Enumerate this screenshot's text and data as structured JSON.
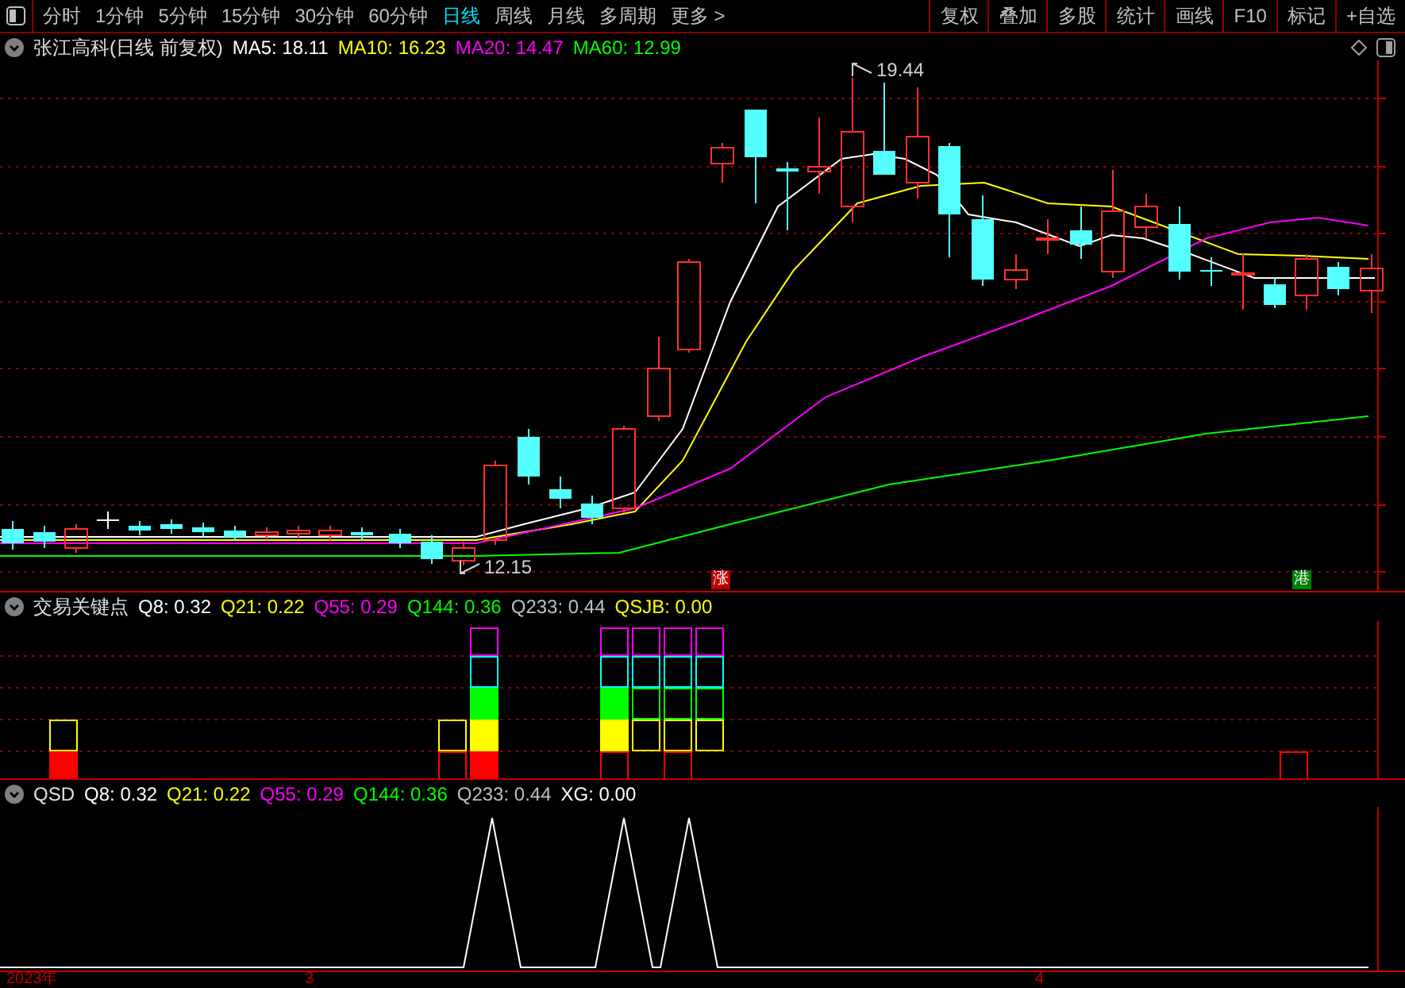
{
  "toolbar": {
    "periods": [
      {
        "label": "分时",
        "selected": false
      },
      {
        "label": "1分钟",
        "selected": false
      },
      {
        "label": "5分钟",
        "selected": false
      },
      {
        "label": "15分钟",
        "selected": false
      },
      {
        "label": "30分钟",
        "selected": false
      },
      {
        "label": "60分钟",
        "selected": false
      },
      {
        "label": "日线",
        "selected": true
      },
      {
        "label": "周线",
        "selected": false
      },
      {
        "label": "月线",
        "selected": false
      },
      {
        "label": "多周期",
        "selected": false
      },
      {
        "label": "更多 >",
        "selected": false
      }
    ],
    "actions": [
      "复权",
      "叠加",
      "多股",
      "统计",
      "画线",
      "F10",
      "标记",
      "+自选"
    ]
  },
  "price_chart": {
    "title": "张江高科(日线 前复权)",
    "indicators": [
      {
        "text": "MA5: 18.11",
        "color": "#ffffff"
      },
      {
        "text": "MA10: 16.23",
        "color": "#ffff00"
      },
      {
        "text": "MA20: 14.47",
        "color": "#ff00ff"
      },
      {
        "text": "MA60: 12.99",
        "color": "#00ff00"
      }
    ],
    "high_label": "19.44",
    "low_label": "12.15",
    "markers": [
      {
        "text": "涨",
        "color": "#c00000"
      },
      {
        "text": "港",
        "color": "#008000"
      }
    ]
  },
  "key_points_panel": {
    "title": "交易关键点",
    "indicators": [
      {
        "text": "Q8: 0.32",
        "color": "#ffffff"
      },
      {
        "text": "Q21: 0.22",
        "color": "#ffff00"
      },
      {
        "text": "Q55: 0.29",
        "color": "#ff00ff"
      },
      {
        "text": "Q144: 0.36",
        "color": "#00ff00"
      },
      {
        "text": "Q233: 0.44",
        "color": "#c0c0c0"
      },
      {
        "text": "QSJB: 0.00",
        "color": "#ffff00"
      }
    ]
  },
  "qsd_panel": {
    "title": "QSD",
    "indicators": [
      {
        "text": "Q8: 0.32",
        "color": "#ffffff"
      },
      {
        "text": "Q21: 0.22",
        "color": "#ffff00"
      },
      {
        "text": "Q55: 0.29",
        "color": "#ff00ff"
      },
      {
        "text": "Q144: 0.36",
        "color": "#00ff00"
      },
      {
        "text": "Q233: 0.44",
        "color": "#c0c0c0"
      },
      {
        "text": "XG: 0.00",
        "color": "#ffffff"
      }
    ]
  },
  "x_axis": [
    "2023年",
    "3",
    "4"
  ]
}
